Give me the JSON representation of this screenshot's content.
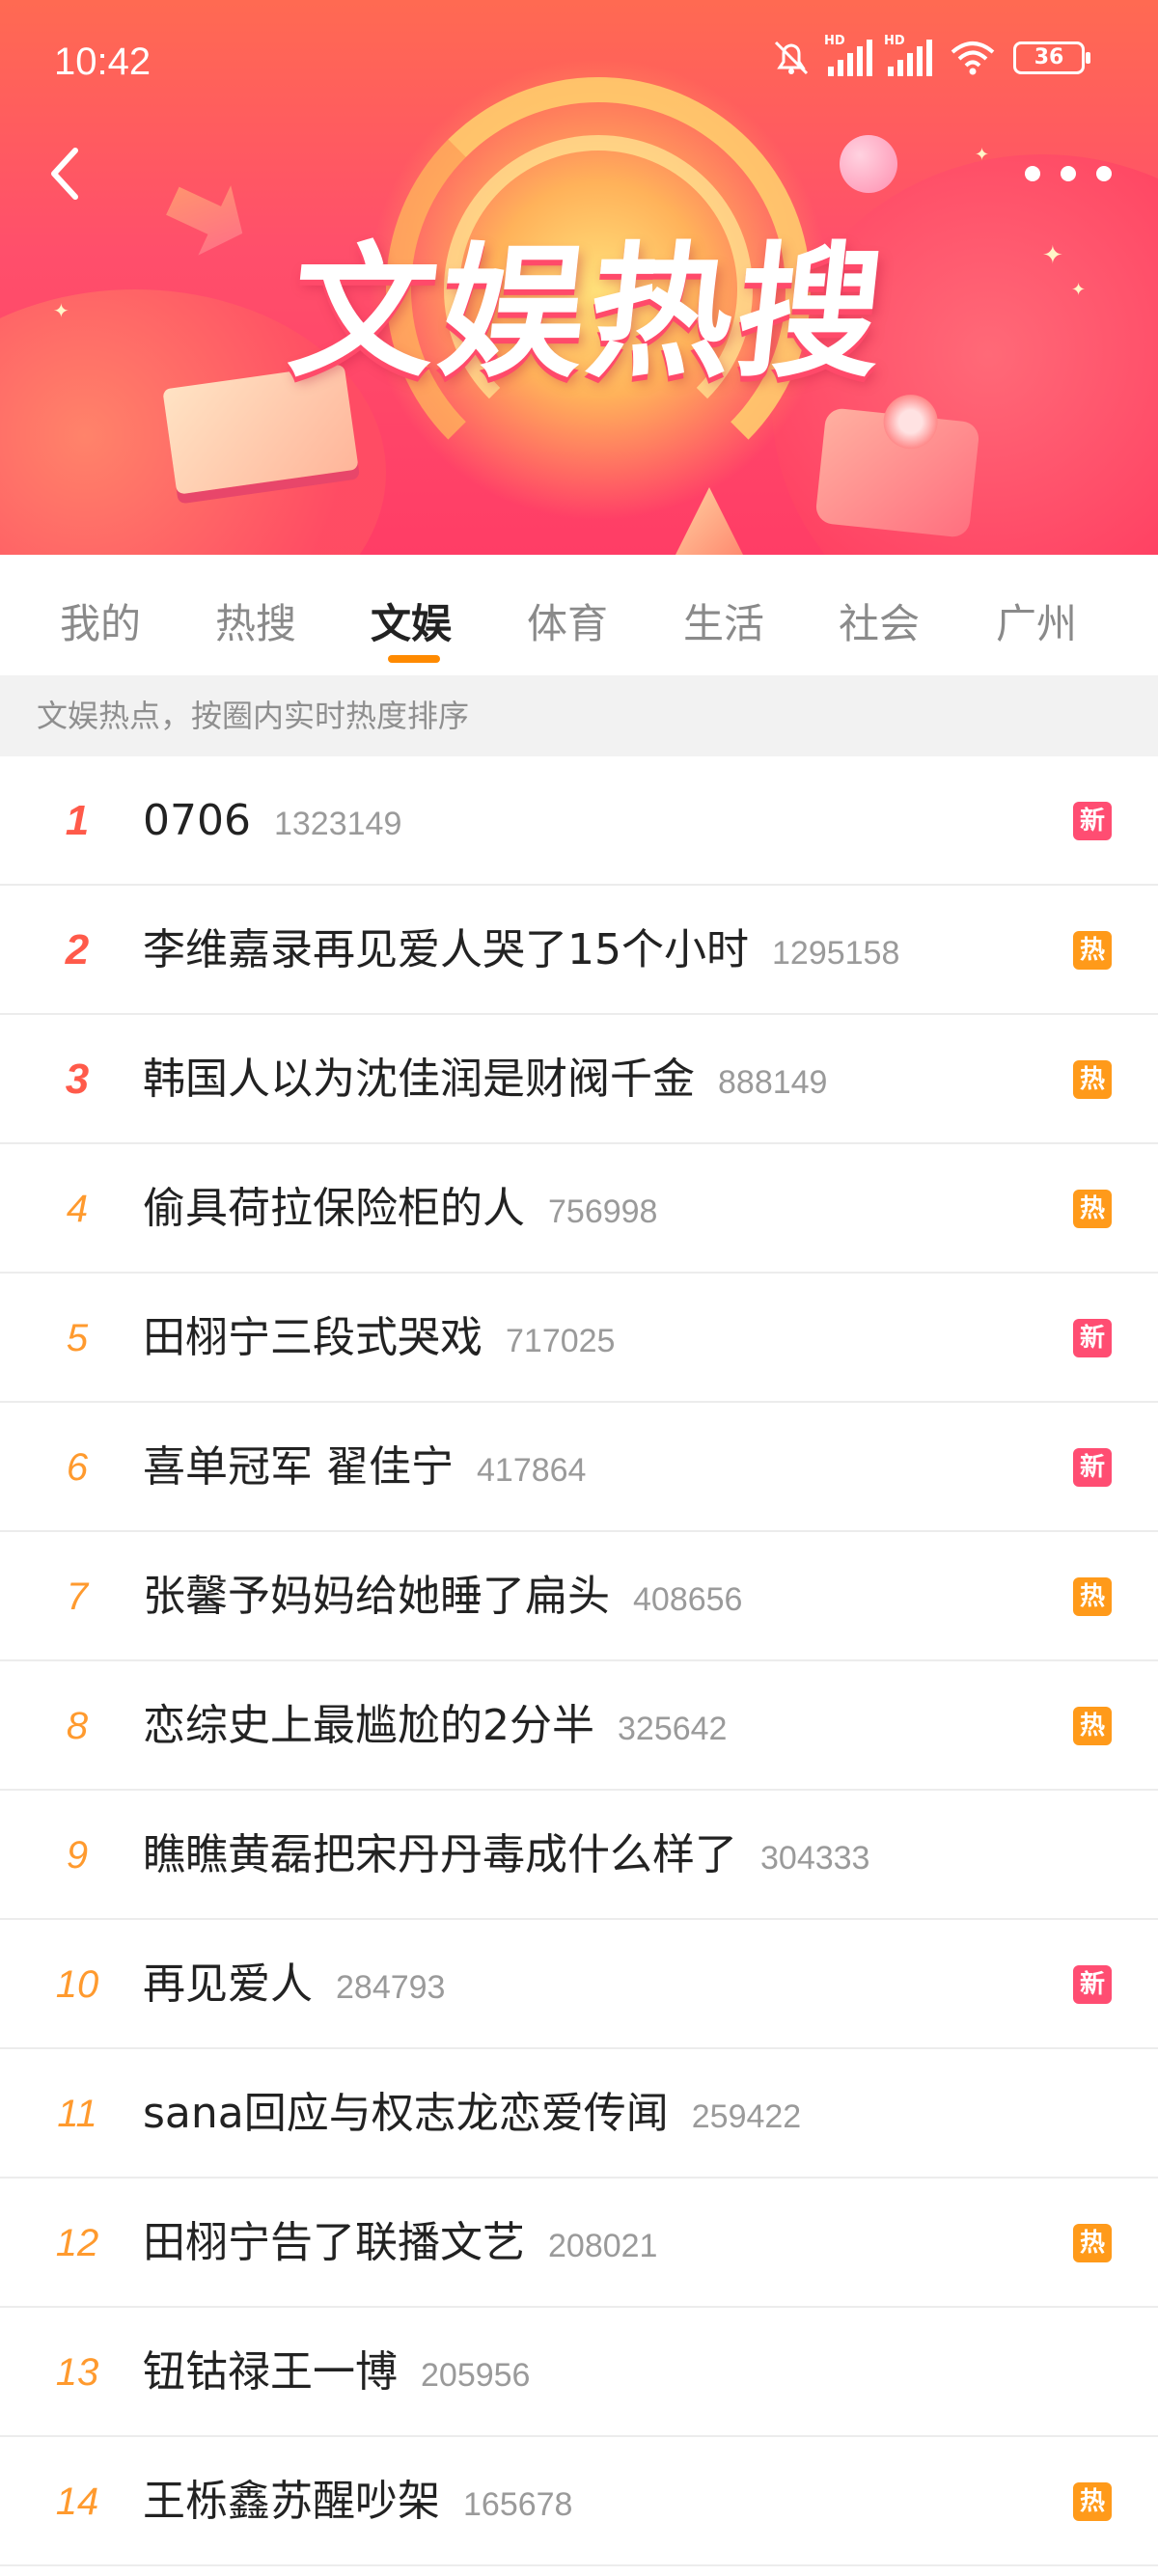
{
  "status_bar": {
    "time": "10:42",
    "battery": "36",
    "icons": [
      "mute-bell-icon",
      "signal-hd-icon",
      "signal-hd-icon",
      "wifi-icon",
      "battery-icon"
    ]
  },
  "header": {
    "title": "文娱热搜",
    "back_icon": "chevron-left-icon",
    "more_icon": "more-dots-icon"
  },
  "tabs": [
    {
      "label": "我的"
    },
    {
      "label": "热搜"
    },
    {
      "label": "文娱"
    },
    {
      "label": "体育"
    },
    {
      "label": "生活"
    },
    {
      "label": "社会"
    },
    {
      "label": "广州"
    }
  ],
  "active_tab": "文娱",
  "hint": "文娱热点，按圈内实时热度排序",
  "badge_colors": {
    "新": "#ff4d72",
    "热": "#ff9a1a"
  },
  "list": [
    {
      "rank": "1",
      "title": "0706",
      "count": "1323149",
      "badge": "新"
    },
    {
      "rank": "2",
      "title": "李维嘉录再见爱人哭了15个小时",
      "count": "1295158",
      "badge": "热"
    },
    {
      "rank": "3",
      "title": "韩国人以为沈佳润是财阀千金",
      "count": "888149",
      "badge": "热"
    },
    {
      "rank": "4",
      "title": "偷具荷拉保险柜的人",
      "count": "756998",
      "badge": "热"
    },
    {
      "rank": "5",
      "title": "田栩宁三段式哭戏",
      "count": "717025",
      "badge": "新"
    },
    {
      "rank": "6",
      "title": "喜单冠军 翟佳宁",
      "count": "417864",
      "badge": "新"
    },
    {
      "rank": "7",
      "title": "张馨予妈妈给她睡了扁头",
      "count": "408656",
      "badge": "热"
    },
    {
      "rank": "8",
      "title": "恋综史上最尴尬的2分半",
      "count": "325642",
      "badge": "热"
    },
    {
      "rank": "9",
      "title": "瞧瞧黄磊把宋丹丹毒成什么样了",
      "count": "304333",
      "badge": ""
    },
    {
      "rank": "10",
      "title": "再见爱人",
      "count": "284793",
      "badge": "新"
    },
    {
      "rank": "11",
      "title": "sana回应与权志龙恋爱传闻",
      "count": "259422",
      "badge": ""
    },
    {
      "rank": "12",
      "title": "田栩宁告了联播文艺",
      "count": "208021",
      "badge": "热"
    },
    {
      "rank": "13",
      "title": "钮钴禄王一博",
      "count": "205956",
      "badge": ""
    },
    {
      "rank": "14",
      "title": "王栎鑫苏醒吵架",
      "count": "165678",
      "badge": "热"
    }
  ]
}
